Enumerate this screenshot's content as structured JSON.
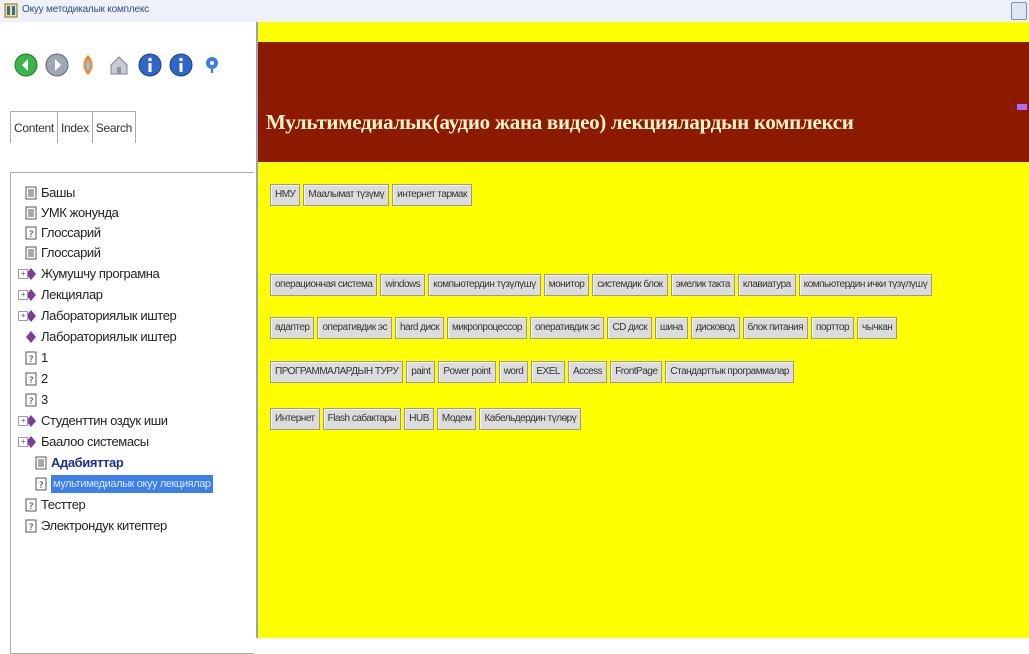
{
  "window": {
    "title": "Окуу методикалык комплекс"
  },
  "toolbar": {
    "icons": [
      "hide-icon",
      "back-icon",
      "stop-icon",
      "home-icon",
      "info-icon",
      "info-icon",
      "info-small-icon"
    ]
  },
  "tabs": [
    {
      "label": "Content",
      "active": true
    },
    {
      "label": "Index",
      "active": false
    },
    {
      "label": "Search",
      "active": false
    }
  ],
  "tree": {
    "items": [
      {
        "label": "Башы",
        "icon": "document-icon"
      },
      {
        "label": "УМК жонунда",
        "icon": "document-icon"
      },
      {
        "label": "Глоссарий",
        "icon": "help-page-icon"
      },
      {
        "label": "Глоссарий",
        "icon": "document-icon"
      },
      {
        "label": "Жумушчу програмна",
        "icon": "book-icon"
      },
      {
        "label": "Лекциялар",
        "icon": "book-icon"
      },
      {
        "label": "Лабораториялык иштер",
        "icon": "book-icon"
      },
      {
        "label": "Лабораториялык иштер",
        "icon": "book-icon"
      },
      {
        "label": "1",
        "icon": "help-page-icon"
      },
      {
        "label": "2",
        "icon": "help-page-icon"
      },
      {
        "label": "3",
        "icon": "help-page-icon"
      },
      {
        "label": "Студенттин оздук иши",
        "icon": "book-icon"
      },
      {
        "label": "Баалоо системасы",
        "icon": "book-icon"
      },
      {
        "label": "Адабияттар",
        "icon": "document-icon"
      },
      {
        "label": "мультимедиалык окуу лекциялар",
        "icon": "help-page-icon"
      },
      {
        "label": "Тесттер",
        "icon": "help-page-icon"
      },
      {
        "label": "Электрондук китептер",
        "icon": "help-page-icon"
      }
    ]
  },
  "main": {
    "heading": "Мультимедиалык(аудио жана видео) лекциялардын комплекси",
    "rows": [
      [
        "НМУ",
        "Маалымат түзүмү",
        "интернет тармак"
      ],
      [
        "операционная система",
        "windows",
        "компьютердин түзүлүшү",
        "монитор",
        "системдик блок",
        "эмелик такта",
        "клавиатура",
        "компьютердин ички түзүлүшү"
      ],
      [
        "адаптер",
        "оперативдик эс",
        "hard диск",
        "микропроцессор",
        "оперативдик эс",
        "CD диск",
        "шина",
        "дисковод",
        "блок питания",
        "порттор",
        "чычкан"
      ],
      [
        "ПРОГРАММАЛАРДЫН ТУРУ",
        "paint",
        "Power point",
        "word",
        "EXEL",
        "Access",
        "FrontPage",
        "Стандарттык программалар"
      ],
      [
        "Интернет",
        "Flash сабактары",
        "HUB",
        "Модем",
        "Кабельдердин түлөрү"
      ]
    ]
  },
  "colors": {
    "banner": "#8b1a00",
    "content_bg": "#ffff00",
    "selection": "#3d7fe8"
  }
}
